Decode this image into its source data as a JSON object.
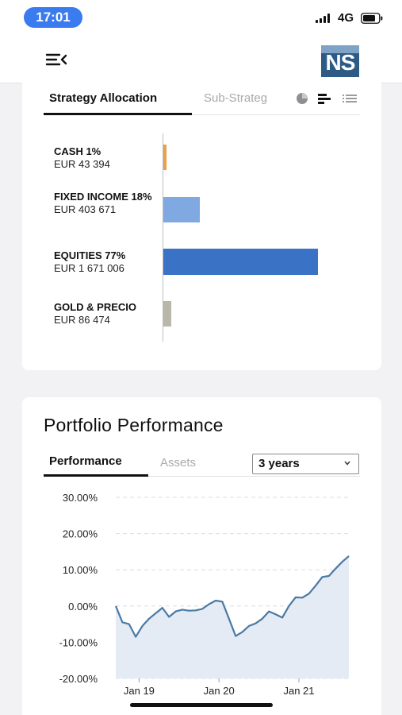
{
  "status_bar": {
    "time": "17:01",
    "network": "4G"
  },
  "allocation": {
    "tabs": [
      {
        "label": "Strategy Allocation",
        "active": true
      },
      {
        "label": "Sub-Strateg",
        "active": false
      }
    ],
    "view_icons": [
      "pie-chart-icon",
      "bar-chart-icon",
      "list-icon"
    ],
    "items": [
      {
        "name": "CASH 1%",
        "value": "EUR 43 394",
        "share": 1,
        "color": "#e8a04a"
      },
      {
        "name": "FIXED INCOME 18%",
        "value": "EUR 403 671",
        "share": 18,
        "color": "#7fa9e0"
      },
      {
        "name": "EQUITIES 77%",
        "value": "EUR 1 671 006",
        "share": 77,
        "color": "#3a72c6"
      },
      {
        "name": "GOLD & PRECIO",
        "value": "EUR 86 474",
        "share": 4,
        "color": "#b9b7a8"
      }
    ]
  },
  "performance": {
    "title": "Portfolio Performance",
    "tabs": [
      {
        "label": "Performance",
        "active": true
      },
      {
        "label": "Assets",
        "active": false
      }
    ],
    "period": {
      "selected": "3 years"
    }
  },
  "chart_data": {
    "type": "area",
    "x_ticks": [
      "Jan 19",
      "Jan 20",
      "Jan 21"
    ],
    "y_ticks": [
      "30.00%",
      "20.00%",
      "10.00%",
      "0.00%",
      "-10.00%",
      "-20.00%"
    ],
    "ylim": [
      -20,
      30
    ],
    "grid": true,
    "line_color": "#4a7aa3",
    "fill_color": "#e4ebf5",
    "series": [
      {
        "values": [
          0,
          -4.5,
          -5,
          -8.5,
          -5.5,
          -3.5,
          -2,
          -0.5,
          -3,
          -1.5,
          -1,
          -1.3,
          -1.2,
          -0.8,
          0.5,
          1.5,
          1.2,
          -3.5,
          -8.3,
          -7.2,
          -5.5,
          -4.8,
          -3.5,
          -1.5,
          -2.3,
          -3.2,
          0,
          2.4,
          2.3,
          3.4,
          5.6,
          8,
          8.3,
          10.3,
          12.2,
          13.8
        ]
      }
    ]
  }
}
